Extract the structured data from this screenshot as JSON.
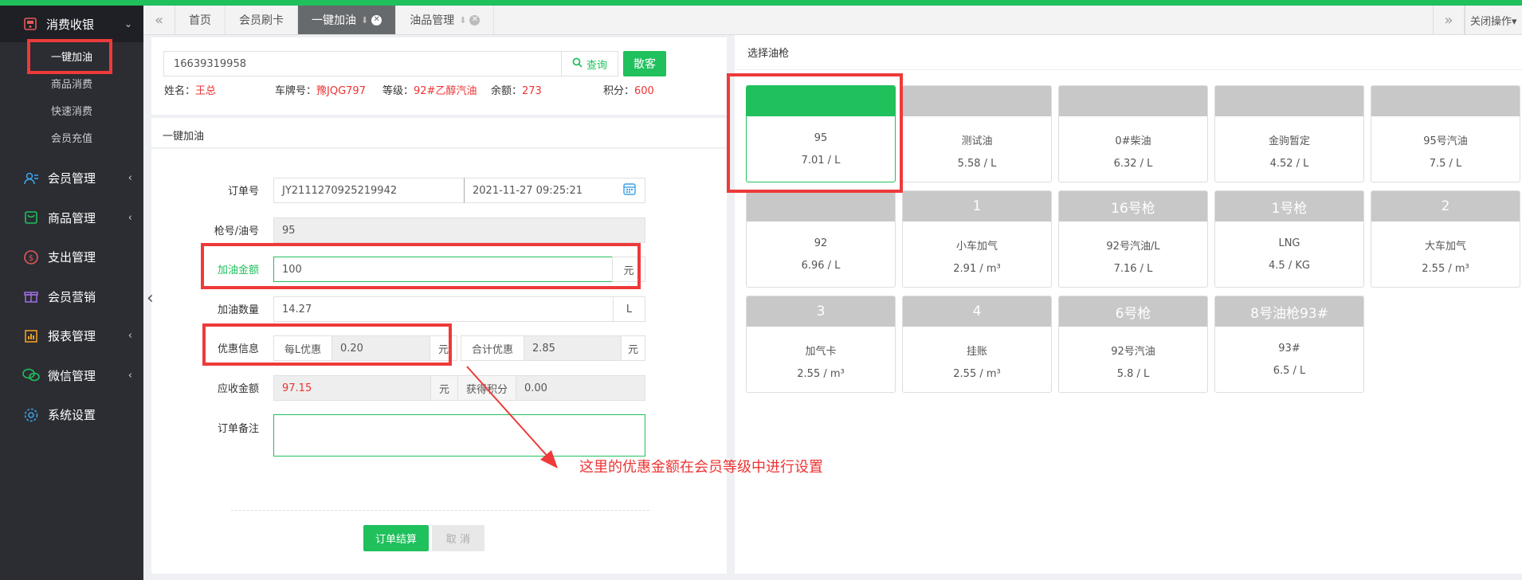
{
  "sidebar": {
    "group_title": "消费收银",
    "sub_items": [
      "一键加油",
      "商品消费",
      "快速消费",
      "会员充值"
    ],
    "items": [
      {
        "label": "会员管理",
        "icon": "members-icon",
        "arrow": "‹"
      },
      {
        "label": "商品管理",
        "icon": "goods-icon",
        "arrow": "‹"
      },
      {
        "label": "支出管理",
        "icon": "expense-icon",
        "arrow": ""
      },
      {
        "label": "会员营销",
        "icon": "gift-icon",
        "arrow": ""
      },
      {
        "label": "报表管理",
        "icon": "report-icon",
        "arrow": "‹"
      },
      {
        "label": "微信管理",
        "icon": "wechat-icon",
        "arrow": "‹"
      },
      {
        "label": "系统设置",
        "icon": "gear-icon",
        "arrow": ""
      }
    ]
  },
  "tabs": {
    "items": [
      "首页",
      "会员刷卡",
      "一键加油",
      "油品管理"
    ],
    "close_ops": "关闭操作▾"
  },
  "search": {
    "phone": "16639319958",
    "query_label": "查询",
    "guest_label": "散客"
  },
  "member": {
    "name_label": "姓名：",
    "name": "王总",
    "plate_label": "车牌号：",
    "plate": "豫JQG797",
    "level_label": "等级：",
    "level": "92#乙醇汽油",
    "balance_label": "余额：",
    "balance": "273",
    "points_label": "积分：",
    "points": "600"
  },
  "form": {
    "title": "一键加油",
    "order_no_label": "订单号",
    "order_no": "JY2111270925219942",
    "order_time": "2021-11-27 09:25:21",
    "gun_label": "枪号/油号",
    "gun": "95",
    "amount_label": "加油金额",
    "amount": "100",
    "amount_unit": "元",
    "qty_label": "加油数量",
    "qty": "14.27",
    "qty_unit": "L",
    "discount_label": "优惠信息",
    "per_l_label": "每L优惠",
    "per_l": "0.20",
    "per_l_unit": "元",
    "total_disc_label": "合计优惠",
    "total_disc": "2.85",
    "total_disc_unit": "元",
    "receivable_label": "应收金额",
    "receivable": "97.15",
    "receivable_unit": "元",
    "points_label": "获得积分",
    "points": "0.00",
    "remark_label": "订单备注",
    "submit_label": "订单结算",
    "cancel_label": "取 消"
  },
  "guns": {
    "title": "选择油枪",
    "items": [
      {
        "head": "",
        "name": "95",
        "price": "7.01 / L",
        "selected": true
      },
      {
        "head": "",
        "name": "测试油",
        "price": "5.58 / L"
      },
      {
        "head": "",
        "name": "0#柴油",
        "price": "6.32 / L"
      },
      {
        "head": "",
        "name": "金驹暂定",
        "price": "4.52 / L"
      },
      {
        "head": "",
        "name": "95号汽油",
        "price": "7.5 / L"
      },
      {
        "head": "",
        "name": "92",
        "price": "6.96 / L"
      },
      {
        "head": "1",
        "name": "小车加气",
        "price": "2.91 / m³"
      },
      {
        "head": "16号枪",
        "name": "92号汽油/L",
        "price": "7.16 / L"
      },
      {
        "head": "1号枪",
        "name": "LNG",
        "price": "4.5 / KG"
      },
      {
        "head": "2",
        "name": "大车加气",
        "price": "2.55 / m³"
      },
      {
        "head": "3",
        "name": "加气卡",
        "price": "2.55 / m³"
      },
      {
        "head": "4",
        "name": "挂账",
        "price": "2.55 / m³"
      },
      {
        "head": "6号枪",
        "name": "92号汽油",
        "price": "5.8 / L"
      },
      {
        "head": "8号油枪93#",
        "name": "93#",
        "price": "6.5 / L"
      }
    ]
  },
  "annotation": "这里的优惠金额在会员等级中进行设置",
  "colors": {
    "accent": "#20c05c",
    "highlight": "#ee3a3a",
    "sidebar": "#2b2d33"
  }
}
